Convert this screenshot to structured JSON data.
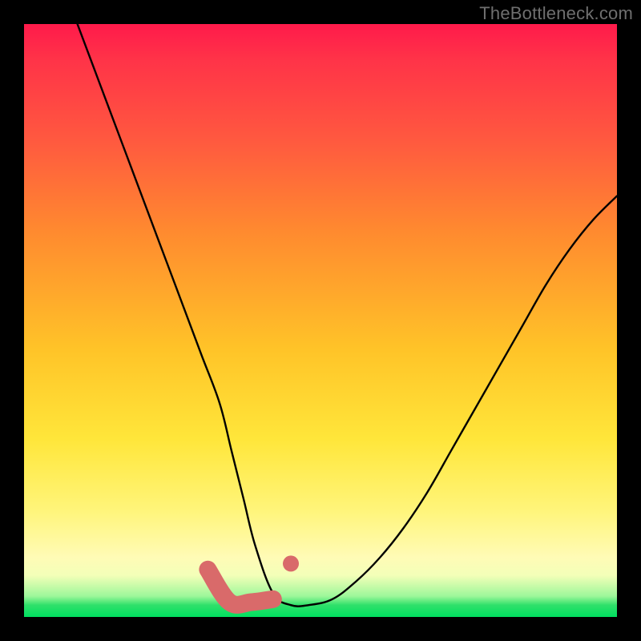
{
  "watermark": "TheBottleneck.com",
  "chart_data": {
    "type": "line",
    "title": "",
    "xlabel": "",
    "ylabel": "",
    "xlim": [
      0,
      100
    ],
    "ylim": [
      0,
      100
    ],
    "grid": false,
    "legend": false,
    "background": {
      "gradient_stops": [
        {
          "pos": 0,
          "color": "#ff1a4b"
        },
        {
          "pos": 20,
          "color": "#ff5a3f"
        },
        {
          "pos": 55,
          "color": "#ffc428"
        },
        {
          "pos": 82,
          "color": "#fff57a"
        },
        {
          "pos": 96,
          "color": "#9df79a"
        },
        {
          "pos": 100,
          "color": "#00e060"
        }
      ]
    },
    "series": [
      {
        "name": "bottleneck-curve",
        "color": "#000000",
        "x": [
          9,
          12,
          15,
          18,
          21,
          24,
          27,
          30,
          33,
          35,
          37,
          39,
          42,
          45,
          48,
          52,
          56,
          60,
          64,
          68,
          72,
          76,
          80,
          84,
          88,
          92,
          96,
          100
        ],
        "y": [
          100,
          92,
          84,
          76,
          68,
          60,
          52,
          44,
          36,
          28,
          20,
          12,
          4,
          2,
          2,
          3,
          6,
          10,
          15,
          21,
          28,
          35,
          42,
          49,
          56,
          62,
          67,
          71
        ]
      }
    ],
    "markers": [
      {
        "name": "flat-band-left-end",
        "x": 31,
        "y": 8
      },
      {
        "name": "flat-band-right-end",
        "x": 42,
        "y": 3
      },
      {
        "name": "detached-dot",
        "x": 45,
        "y": 9
      }
    ],
    "annotations": []
  }
}
